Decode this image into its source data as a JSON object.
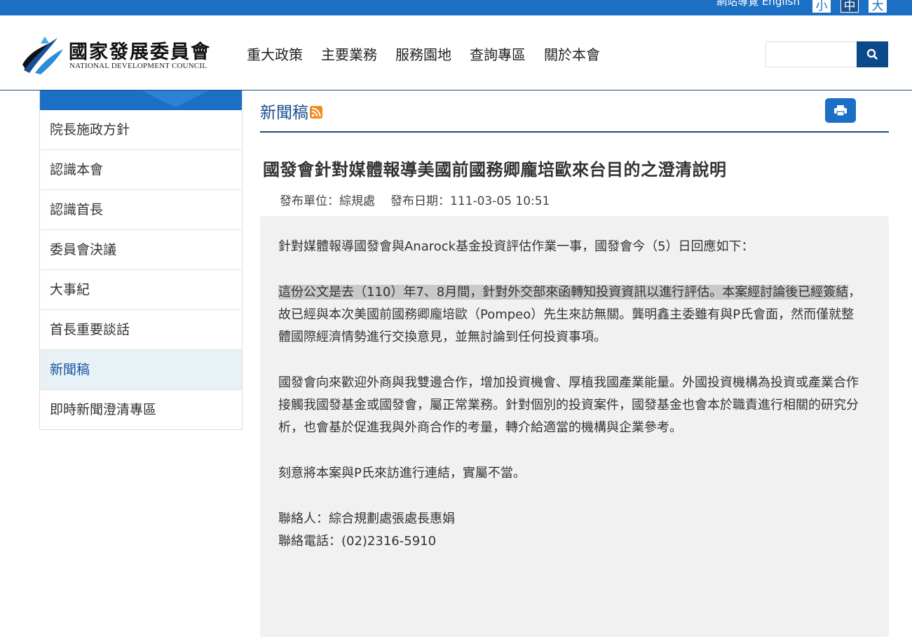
{
  "topbar": {
    "links": "網站導覽 English",
    "font_small": "小",
    "font_medium": "中",
    "font_large": "大"
  },
  "logo": {
    "cn": "國家發展委員會",
    "en": "NATIONAL DEVELOPMENT COUNCIL"
  },
  "nav": [
    "重大政策",
    "主要業務",
    "服務園地",
    "查詢專區",
    "關於本會"
  ],
  "search": {
    "placeholder": ""
  },
  "sidebar": {
    "items": [
      {
        "label": "院長施政方針"
      },
      {
        "label": "認識本會"
      },
      {
        "label": "認識首長"
      },
      {
        "label": "委員會決議"
      },
      {
        "label": "大事紀"
      },
      {
        "label": "首長重要談話"
      },
      {
        "label": "新聞稿"
      },
      {
        "label": "即時新聞澄清專區"
      }
    ],
    "active_index": 6
  },
  "section": {
    "title": "新聞稿"
  },
  "article": {
    "title": "國發會針對媒體報導美國前國務卿龐培歐來台目的之澄清說明",
    "unit": "發布單位：綜規處",
    "date": "發布日期：111-03-05 10:51",
    "p1": "針對媒體報導國發會與Anarock基金投資評估作業一事，國發會今（5）日回應如下：",
    "p2_highlight": "這份公文是去（110）年7、8月間，針對外交部來函轉知投資資訊以進行評估。本案經討論後已經簽結",
    "p2_rest": "，故已經與本次美國前國務卿龐培歐（Pompeo）先生來訪無關。龔明鑫主委雖有與P氏會面，然而僅就整體國際經濟情勢進行交換意見，並無討論到任何投資事項。",
    "p3": "國發會向來歡迎外商與我雙邊合作，增加投資機會、厚植我國產業能量。外國投資機構為投資或產業合作接觸我國發基金或國發會，屬正常業務。針對個別的投資案件，國發基金也會本於職責進行相關的研究分析，也會基於促進我與外商合作的考量，轉介給適當的機構與企業參考。",
    "p4": "刻意將本案與P氏來訪進行連結，實屬不當。",
    "contact": "聯絡人：綜合規劃處張處長惠娟",
    "phone": "聯絡電話：(02)2316-5910"
  },
  "colors": {
    "topbar": "#1b6fc4",
    "accent_dark": "#0a4a8a",
    "sidebar_active_bg": "#e7f1f6",
    "content_bg": "#f1f1f1",
    "highlight": "#c9c9c9"
  },
  "icons": [
    "logo-mark-icon",
    "search-icon",
    "rss-icon",
    "print-icon"
  ]
}
